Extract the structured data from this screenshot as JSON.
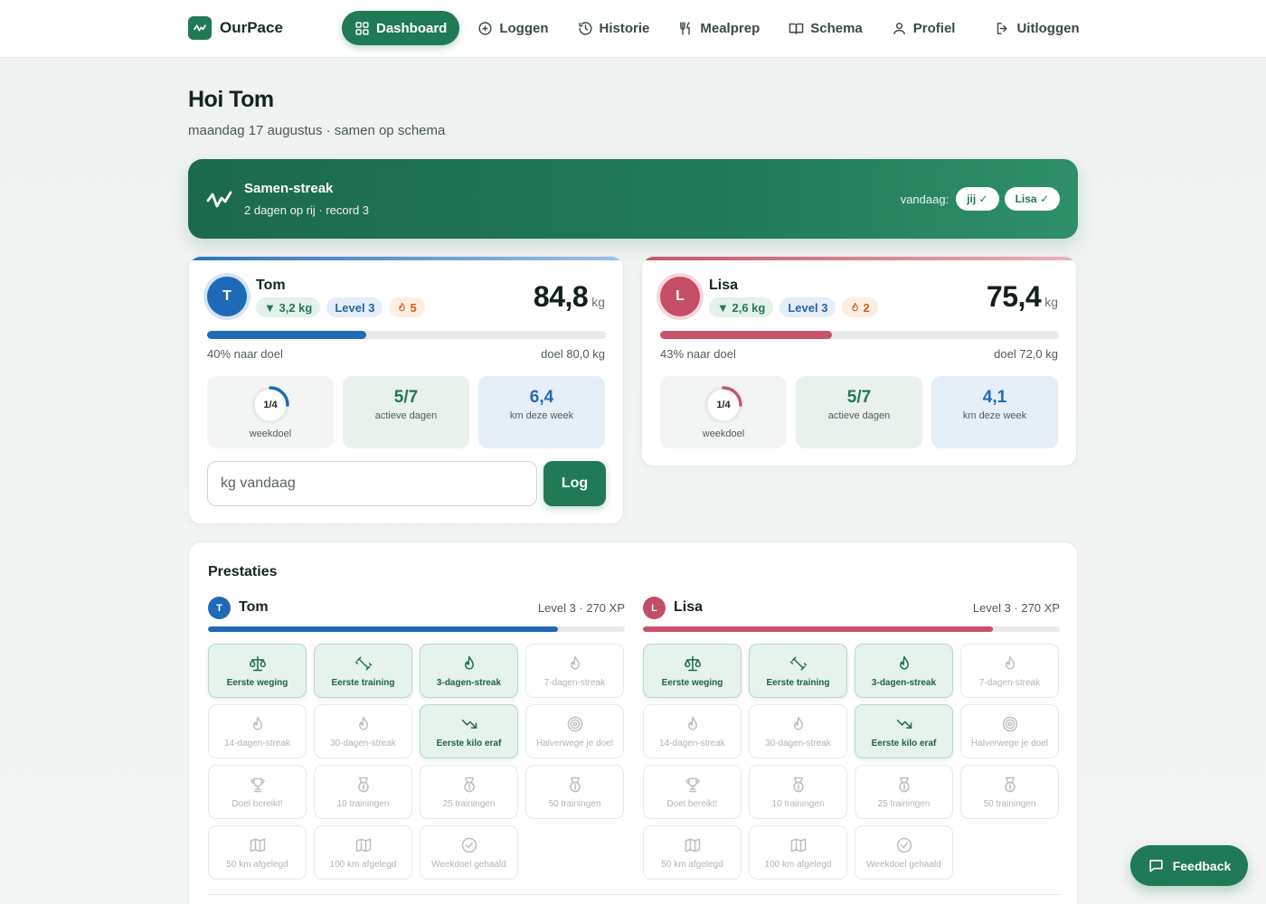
{
  "brand": {
    "name": "OurPace"
  },
  "nav": {
    "items": [
      {
        "label": "Dashboard",
        "icon": "grid-icon",
        "active": true
      },
      {
        "label": "Loggen",
        "icon": "plus-circle-icon"
      },
      {
        "label": "Historie",
        "icon": "history-icon"
      },
      {
        "label": "Mealprep",
        "icon": "utensils-icon"
      },
      {
        "label": "Schema",
        "icon": "book-icon"
      },
      {
        "label": "Profiel",
        "icon": "user-icon"
      }
    ],
    "logout": "Uitloggen"
  },
  "header": {
    "greeting": "Hoi Tom",
    "subtitle": "maandag 17 augustus · samen op schema"
  },
  "streak": {
    "title": "Samen-streak",
    "subtitle": "2 dagen op rij · record 3",
    "today_label": "vandaag:",
    "me": "jij ✓",
    "partner": "Lisa ✓"
  },
  "people": [
    {
      "initial": "T",
      "name": "Tom",
      "loss": "▼ 3,2 kg",
      "level": "Level 3",
      "streak": "5",
      "weight": "84,8",
      "unit": "kg",
      "progress": 0.4,
      "progress_label": "40% naar doel",
      "goal": "doel 80,0 kg",
      "weekgoal": "1/4",
      "weekgoal_fraction": 0.25,
      "weekgoal_label": "weekdoel",
      "active_days": "5/7",
      "active_label": "actieve dagen",
      "km": "6,4",
      "km_label": "km deze week",
      "color": "#1f6ab8"
    },
    {
      "initial": "L",
      "name": "Lisa",
      "loss": "▼ 2,6 kg",
      "level": "Level 3",
      "streak": "2",
      "weight": "75,4",
      "unit": "kg",
      "progress": 0.43,
      "progress_label": "43% naar doel",
      "goal": "doel 72,0 kg",
      "weekgoal": "1/4",
      "weekgoal_fraction": 0.25,
      "weekgoal_label": "weekdoel",
      "active_days": "5/7",
      "active_label": "actieve dagen",
      "km": "4,1",
      "km_label": "km deze week",
      "color": "#c9536a"
    }
  ],
  "log": {
    "placeholder": "kg vandaag",
    "button": "Log"
  },
  "achievements": {
    "title": "Prestaties",
    "columns": [
      {
        "initial": "T",
        "name": "Tom",
        "xp": "Level 3 · 270 XP",
        "xp_progress": 0.84
      },
      {
        "initial": "L",
        "name": "Lisa",
        "xp": "Level 3 · 270 XP",
        "xp_progress": 0.84
      }
    ],
    "items": [
      {
        "label": "Eerste weging",
        "icon": "scale-icon",
        "on": true
      },
      {
        "label": "Eerste training",
        "icon": "dumbbell-icon",
        "on": true
      },
      {
        "label": "3-dagen-streak",
        "icon": "flame-icon",
        "on": true
      },
      {
        "label": "7-dagen-streak",
        "icon": "flame-icon",
        "on": false
      },
      {
        "label": "14-dagen-streak",
        "icon": "flame-icon",
        "on": false
      },
      {
        "label": "30-dagen-streak",
        "icon": "flame-icon",
        "on": false
      },
      {
        "label": "Eerste kilo eraf",
        "icon": "trend-down-icon",
        "on": true
      },
      {
        "label": "Halverwege je doel",
        "icon": "target-icon",
        "on": false
      },
      {
        "label": "Doel bereikt!",
        "icon": "trophy-icon",
        "on": false
      },
      {
        "label": "10 trainingen",
        "icon": "medal-icon",
        "on": false
      },
      {
        "label": "25 trainingen",
        "icon": "medal-icon",
        "on": false
      },
      {
        "label": "50 trainingen",
        "icon": "medal-icon",
        "on": false
      },
      {
        "label": "50 km afgelegd",
        "icon": "map-icon",
        "on": false
      },
      {
        "label": "100 km afgelegd",
        "icon": "map-icon",
        "on": false
      },
      {
        "label": "Weekdoel gehaald",
        "icon": "check-circle-icon",
        "on": false
      }
    ]
  },
  "feedback": {
    "label": "Feedback"
  }
}
